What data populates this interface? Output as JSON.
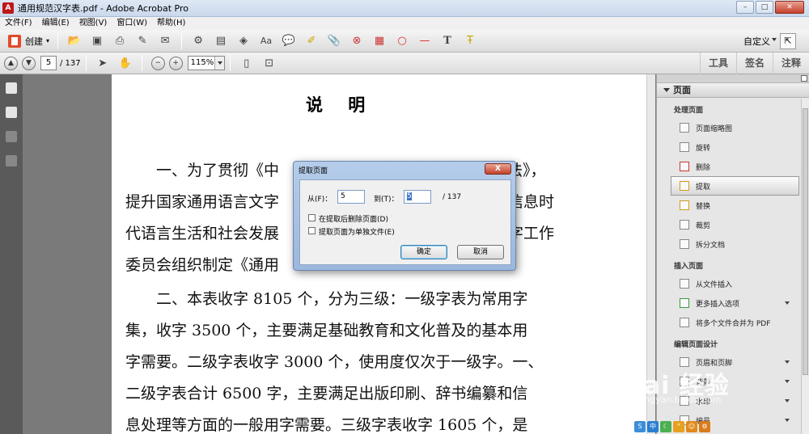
{
  "window": {
    "title": "通用规范汉字表.pdf - Adobe Acrobat Pro",
    "app_icon": "acrobat-icon",
    "controls": [
      "minimize",
      "maximize",
      "close"
    ]
  },
  "menu": [
    "文件(F)",
    "编辑(E)",
    "视图(V)",
    "窗口(W)",
    "帮助(H)"
  ],
  "toolbar1": {
    "create_label": "创建",
    "customize_label": "自定义"
  },
  "toolbar2": {
    "current_page": "5",
    "total_pages": "/ 137",
    "zoom": "115%",
    "tabs": [
      "工具",
      "签名",
      "注释"
    ]
  },
  "document": {
    "title": "说 明",
    "paragraphs": [
      "一、为了贯彻《中",
      "提升国家通用语言文字",
      "代语言生活和社会发展",
      "委员会组织制定《通用",
      "二、本表收字 8105 个，分为三级：一级字表为常用字",
      "集，收字 3500 个，主要满足基础教育和文化普及的基本用",
      "字需要。二级字表收字 3000 个，使用度仅次于一级字。一、",
      "二级字表合计 6500 字，主要满足出版印刷、辞书编纂和信",
      "息处理等方面的一般用字需要。三级字表收字 1605 个，是"
    ],
    "right_fragments": [
      "字法》，",
      "信息时",
      "字工作"
    ]
  },
  "panel": {
    "header": "页面",
    "sections": [
      {
        "title": "处理页面",
        "items": [
          {
            "label": "页面缩略图",
            "icon": "thumbnails-icon"
          },
          {
            "label": "旋转",
            "icon": "rotate-icon"
          },
          {
            "label": "删除",
            "icon": "delete-icon"
          },
          {
            "label": "提取",
            "icon": "extract-icon",
            "selected": true
          },
          {
            "label": "替换",
            "icon": "replace-icon"
          },
          {
            "label": "裁剪",
            "icon": "crop-icon"
          },
          {
            "label": "拆分文档",
            "icon": "split-icon"
          }
        ]
      },
      {
        "title": "插入页面",
        "items": [
          {
            "label": "从文件插入",
            "icon": "insert-file-icon"
          },
          {
            "label": "更多插入选项",
            "icon": "more-insert-icon"
          },
          {
            "label": "将多个文件合并为 PDF",
            "icon": "combine-icon"
          }
        ]
      },
      {
        "title": "编辑页面设计",
        "items": [
          {
            "label": "页眉和页脚",
            "icon": "header-footer-icon"
          },
          {
            "label": "背景",
            "icon": "background-icon"
          },
          {
            "label": "水印",
            "icon": "watermark-icon"
          },
          {
            "label": "编号",
            "icon": "numbering-icon"
          }
        ]
      }
    ]
  },
  "dialog": {
    "title": "提取页面",
    "close_label": "X",
    "from_label": "从(F)：",
    "from_value": "5",
    "to_label": "到(T)：",
    "to_value": "5",
    "total": "/ 137",
    "option_delete": "在提取后删除页面(D)",
    "option_separate": "提取页面为单独文件(E)",
    "ok_label": "确定",
    "cancel_label": "取消"
  },
  "watermark": {
    "text": "Bai 经验",
    "sub": "jingyan.baidu.com"
  }
}
